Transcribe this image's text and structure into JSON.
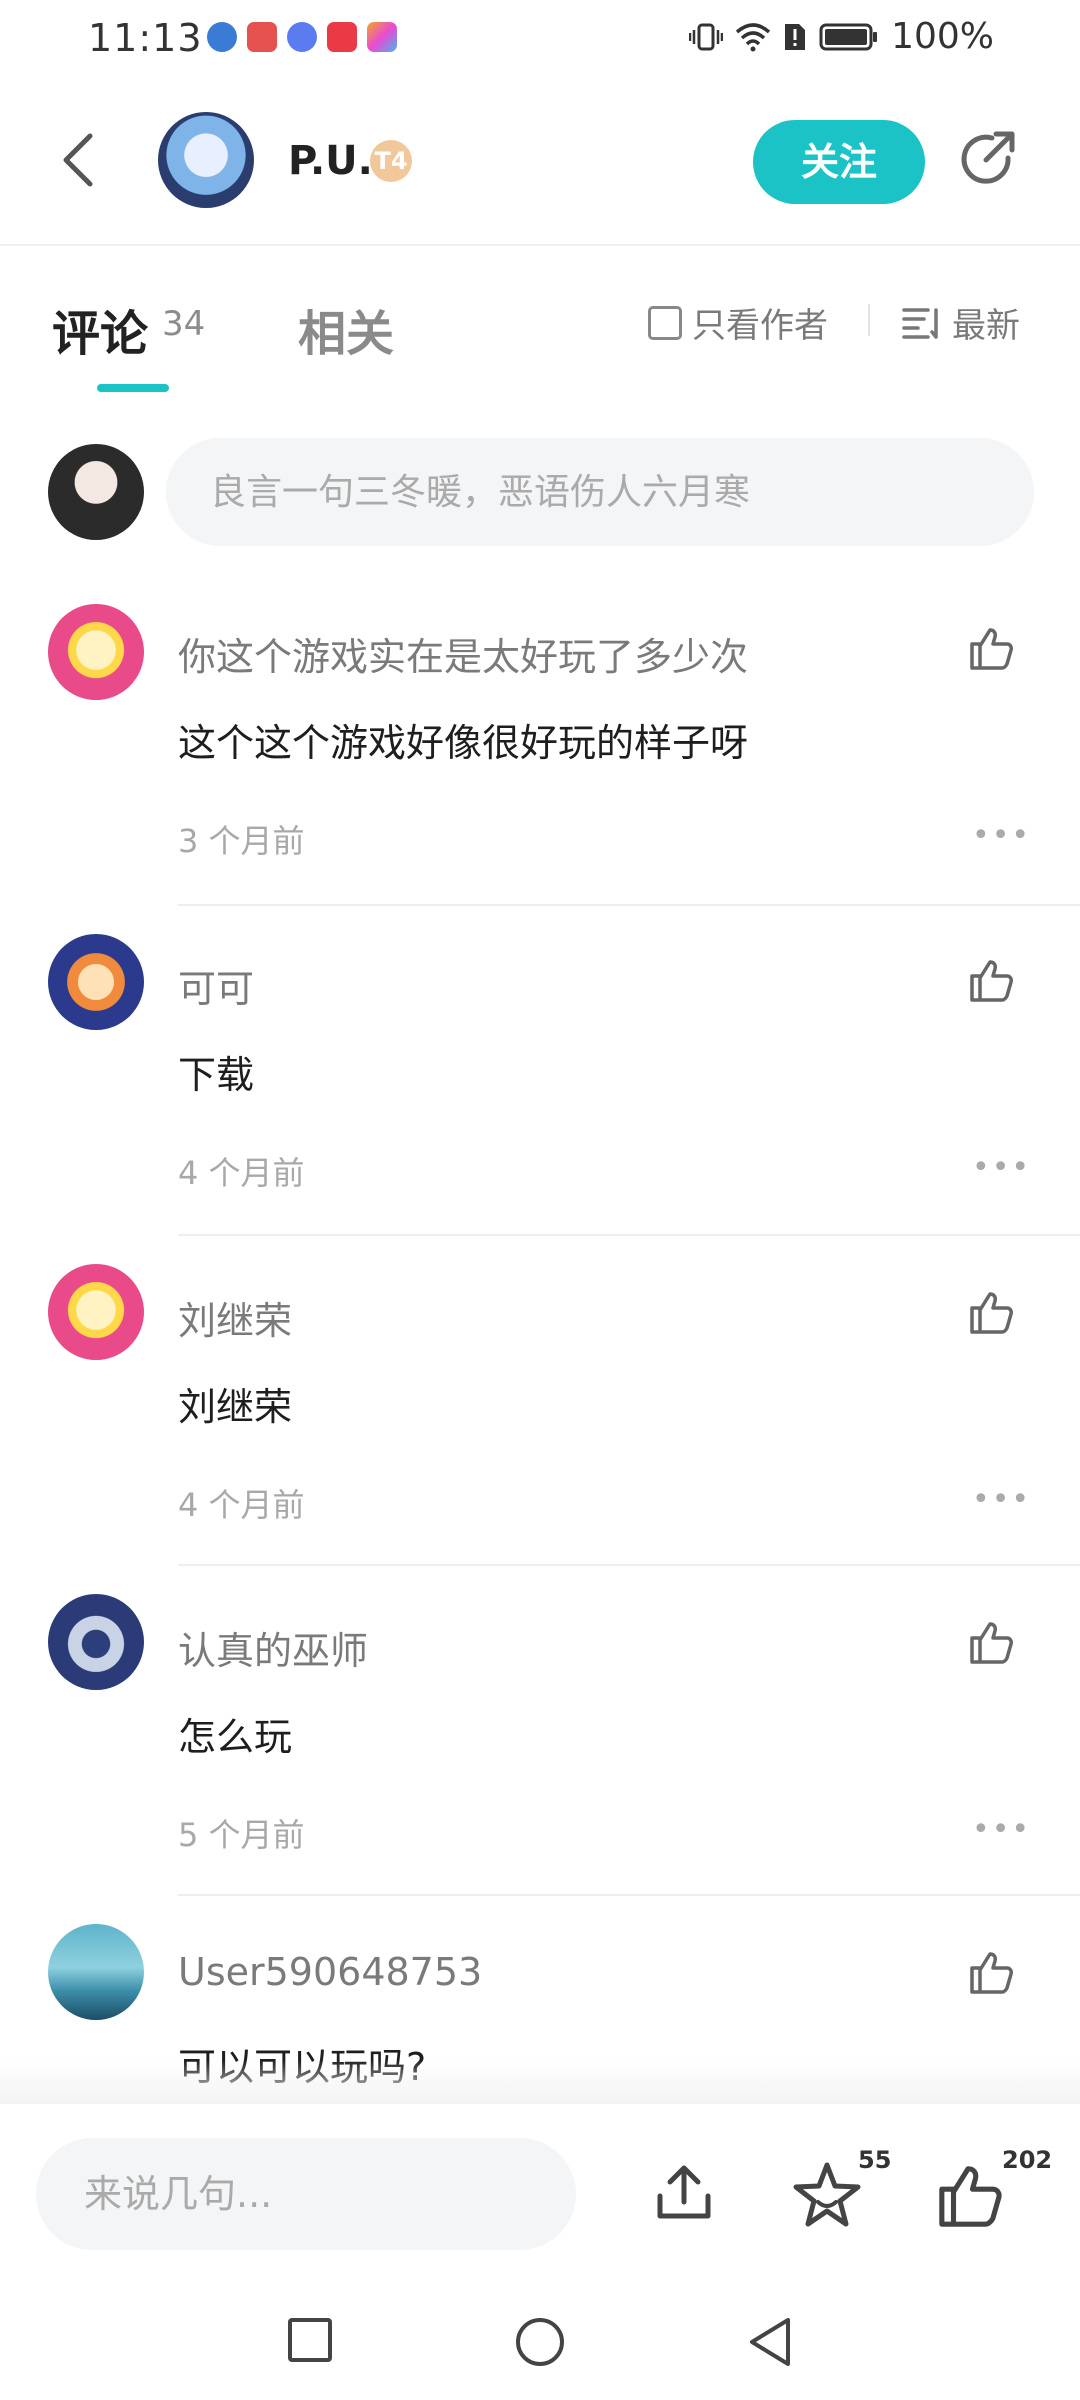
{
  "status_bar": {
    "time": "11:13",
    "battery": "100%",
    "app_icons": [
      "#3a7bd5",
      "#e4514f",
      "#5b7cf0",
      "#e93a46",
      "#f5a623"
    ]
  },
  "header": {
    "author_name": "P.U.",
    "level_badge": "T4",
    "follow_label": "关注"
  },
  "tabs": {
    "comments_label": "评论",
    "comments_count": "34",
    "related_label": "相关",
    "author_only_label": "只看作者",
    "sort_label": "最新"
  },
  "comment_box": {
    "placeholder": "良言一句三冬暖，恶语伤人六月寒"
  },
  "comments": [
    {
      "name": "你这个游戏实在是太好玩了多少次",
      "text": "这个这个游戏好像很好玩的样子呀",
      "time": "3 个月前"
    },
    {
      "name": "可可",
      "text": "下载",
      "time": "4 个月前"
    },
    {
      "name": "刘继荣",
      "text": "刘继荣",
      "time": "4 个月前"
    },
    {
      "name": "认真的巫师",
      "text": "怎么玩",
      "time": "5 个月前"
    },
    {
      "name": "User590648753",
      "text": "可以可以玩吗?",
      "time": ""
    }
  ],
  "bottom_bar": {
    "placeholder": "来说几句...",
    "favorite_count": "55",
    "like_count": "202"
  },
  "colors": {
    "accent": "#1cc3c6"
  }
}
